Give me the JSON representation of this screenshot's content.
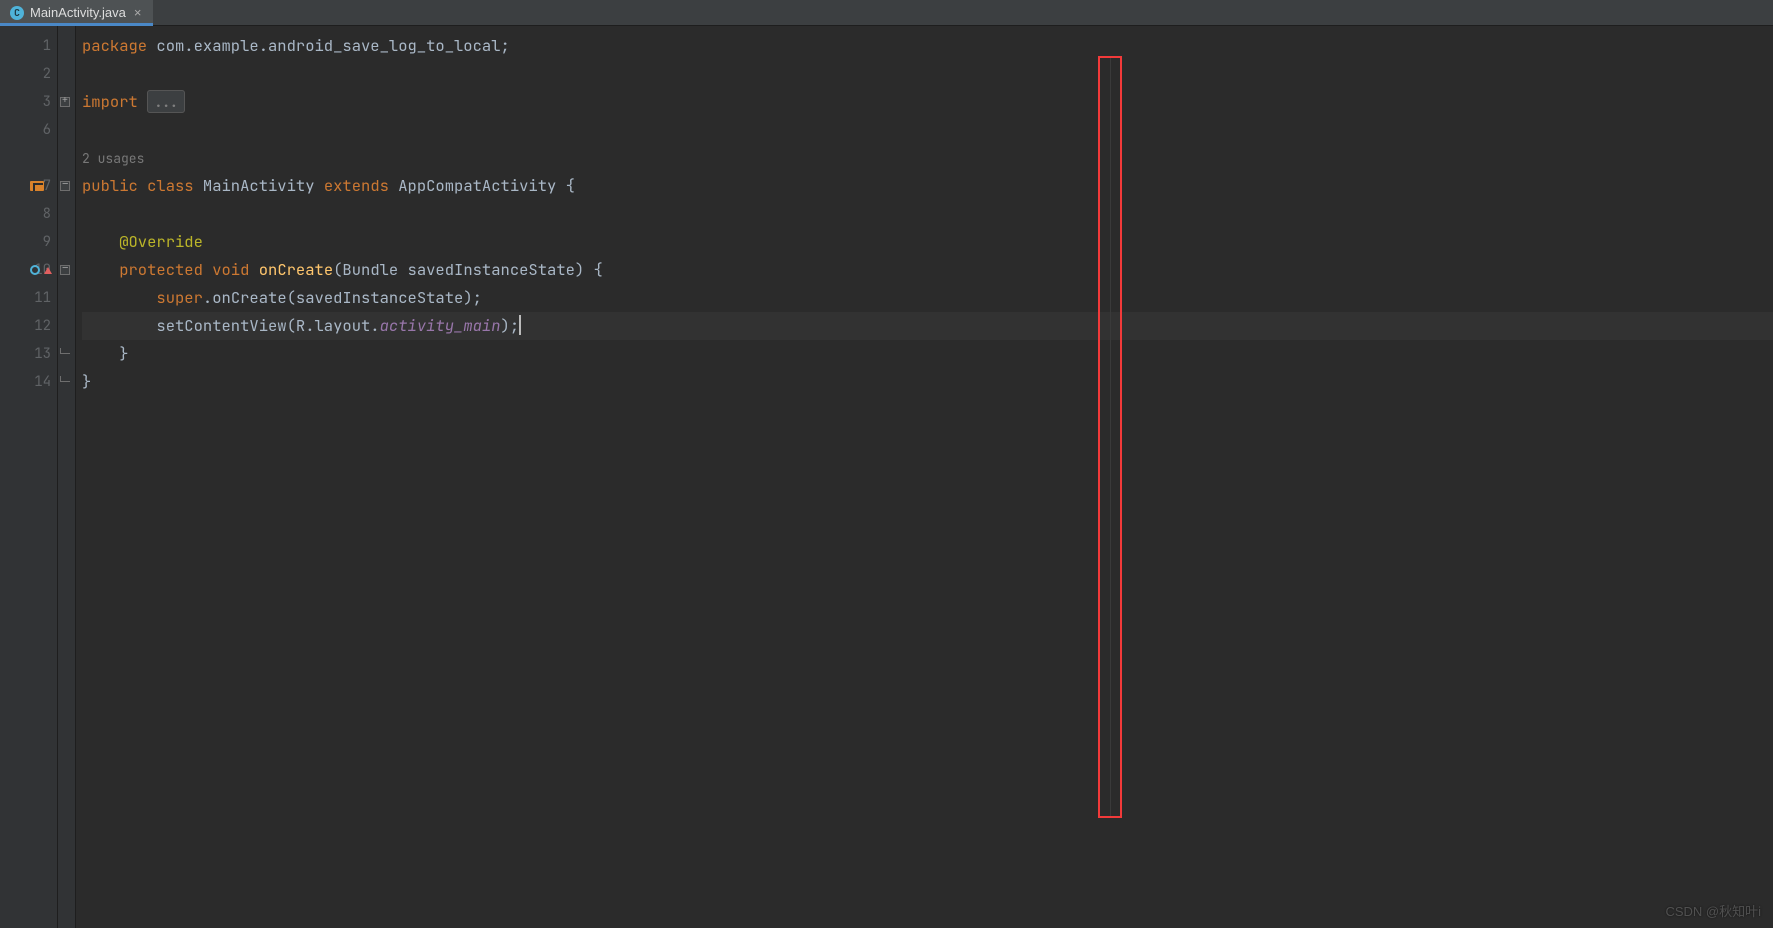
{
  "tab": {
    "label": "MainActivity.java",
    "icon_letter": "C"
  },
  "gutter_lines": [
    "1",
    "2",
    "3",
    "6",
    "",
    "7",
    "8",
    "9",
    "10",
    "11",
    "12",
    "13",
    "14"
  ],
  "hint_text": "2 usages",
  "code": {
    "l1": {
      "kw1": "package ",
      "rest": "com.example.android_save_log_to_local;"
    },
    "l3": {
      "kw1": "import ",
      "fold": "..."
    },
    "l7": {
      "kw1": "public class ",
      "name": "MainActivity ",
      "kw2": "extends ",
      "parent": "AppCompatActivity ",
      "brace": "{"
    },
    "l9": {
      "ann": "@Override"
    },
    "l10": {
      "kw1": "protected void ",
      "fn": "onCreate",
      "args": "(Bundle savedInstanceState) {",
      "open": ""
    },
    "l11": {
      "kw1": "super",
      "dot": ".onCreate(savedInstanceState);"
    },
    "l12": {
      "fn": "setContentView",
      "open": "(R.layout.",
      "field": "activity_main",
      "close": ");"
    },
    "l13": {
      "brace": "}"
    },
    "l14": {
      "brace": "}"
    }
  },
  "right_marker_left_px": 1098,
  "watermark": "CSDN @秋知叶i"
}
